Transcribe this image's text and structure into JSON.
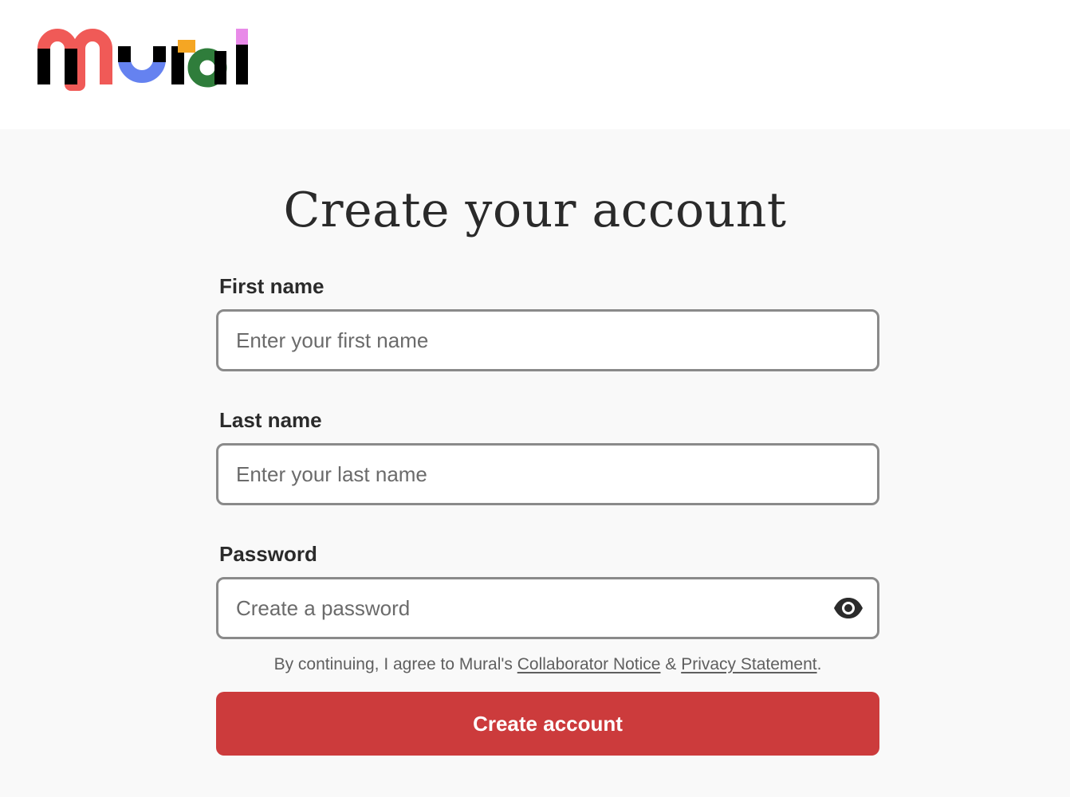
{
  "brand": {
    "name": "Mural",
    "logo_icon": "mural-logo",
    "colors": {
      "red": "#f05a57",
      "blue": "#6582f0",
      "orange": "#f5a623",
      "green": "#2f7d3b",
      "pink": "#e88ae8",
      "black": "#000000"
    }
  },
  "form": {
    "title": "Create your account",
    "first_name": {
      "label": "First name",
      "placeholder": "Enter your first name",
      "value": ""
    },
    "last_name": {
      "label": "Last name",
      "placeholder": "Enter your last name",
      "value": ""
    },
    "password": {
      "label": "Password",
      "placeholder": "Create a password",
      "value": "",
      "toggle_icon": "eye-icon"
    },
    "consent": {
      "prefix": "By continuing, I agree to Mural's ",
      "link1": "Collaborator Notice",
      "separator": " & ",
      "link2": "Privacy Statement",
      "suffix": "."
    },
    "submit_label": "Create account",
    "submit_color": "#cc3b3c"
  }
}
